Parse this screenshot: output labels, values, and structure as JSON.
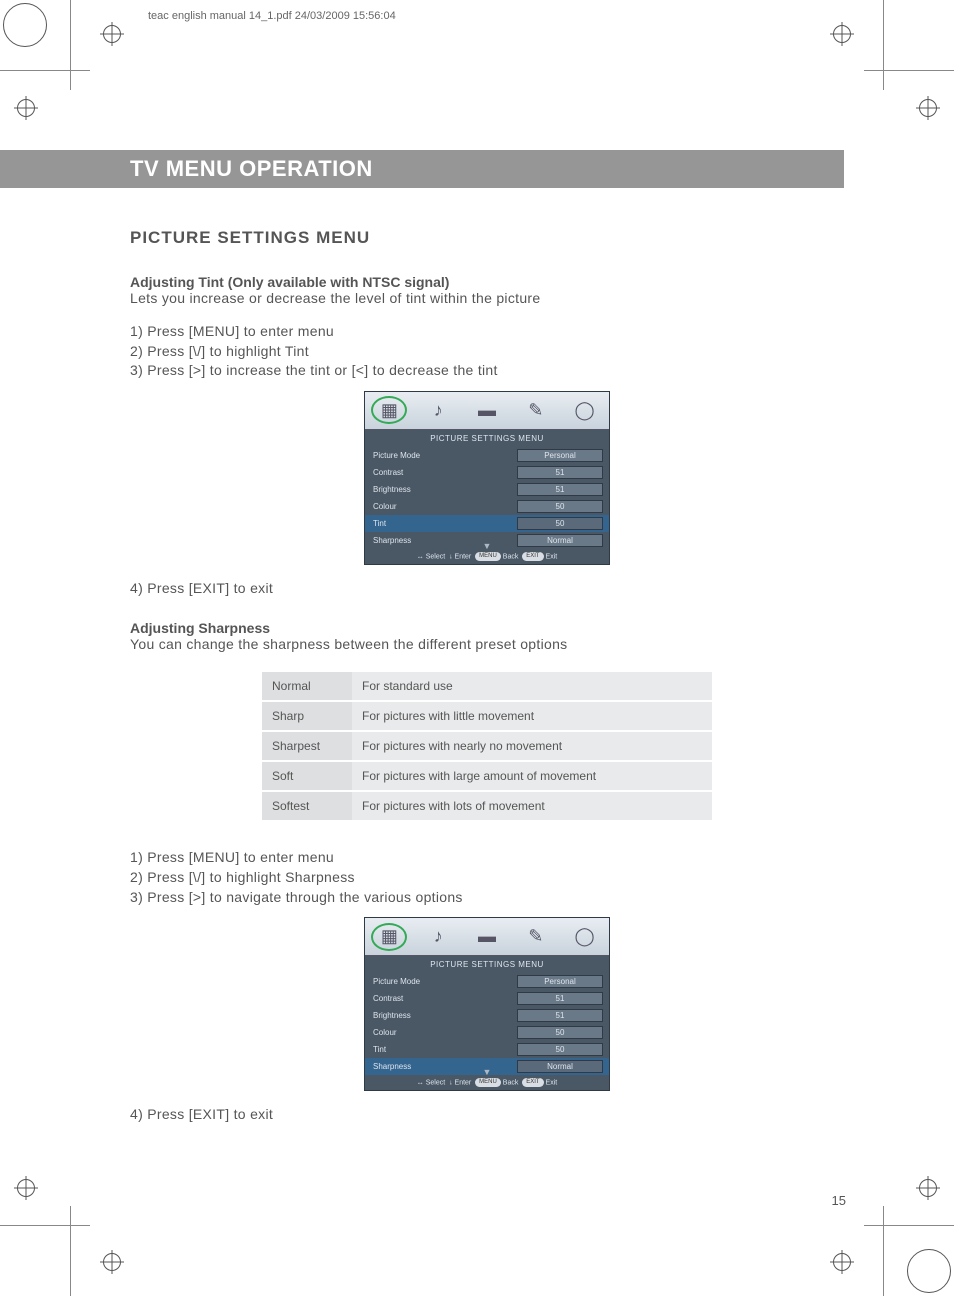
{
  "header_text": "teac english manual 14_1.pdf   24/03/2009   15:56:04",
  "title": "TV MENU OPERATION",
  "subtitle": "PICTURE SETTINGS MENU",
  "tint": {
    "heading": "Adjusting Tint (Only available with NTSC signal)",
    "desc": "Lets you increase or decrease the level of tint within the picture",
    "steps": [
      "1) Press [MENU] to enter menu",
      "2) Press [\\/] to highlight Tint",
      "3) Press [>] to increase the tint or [<] to decrease the tint"
    ],
    "exit": "4) Press [EXIT] to exit"
  },
  "sharpness": {
    "heading": "Adjusting Sharpness",
    "desc": "You can change the sharpness between the different preset options",
    "table": [
      {
        "name": "Normal",
        "desc": "For standard use"
      },
      {
        "name": "Sharp",
        "desc": "For pictures with little movement"
      },
      {
        "name": "Sharpest",
        "desc": "For pictures with nearly no movement"
      },
      {
        "name": "Soft",
        "desc": "For pictures with large amount of movement"
      },
      {
        "name": "Softest",
        "desc": "For pictures with lots of movement"
      }
    ],
    "steps": [
      "1) Press [MENU] to enter menu",
      "2) Press [\\/] to highlight Sharpness",
      "3) Press [>] to navigate through the various options"
    ],
    "exit": "4) Press [EXIT] to exit"
  },
  "osd": {
    "title": "PICTURE SETTINGS MENU",
    "rows": [
      {
        "label": "Picture Mode",
        "value": "Personal"
      },
      {
        "label": "Contrast",
        "value": "51"
      },
      {
        "label": "Brightness",
        "value": "51"
      },
      {
        "label": "Colour",
        "value": "50"
      },
      {
        "label": "Tint",
        "value": "50"
      },
      {
        "label": "Sharpness",
        "value": "Normal"
      }
    ],
    "footer": {
      "select": "Select",
      "enter": "Enter",
      "menu_pill": "MENU",
      "back": "Back",
      "exit_pill": "EXIT",
      "exit": "Exit"
    },
    "highlight_tint_index": 4,
    "highlight_sharp_index": 5
  },
  "page_number": "15"
}
